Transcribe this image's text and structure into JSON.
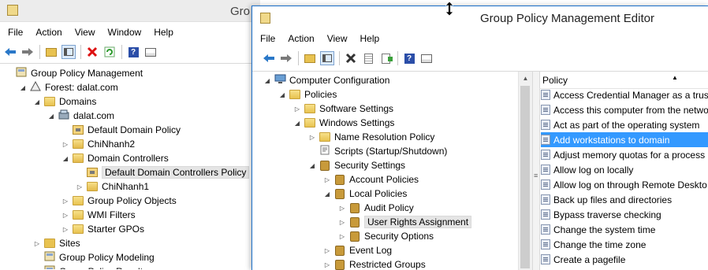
{
  "back_window": {
    "title_partial": "Gro",
    "menu": [
      "File",
      "Action",
      "View",
      "Window",
      "Help"
    ],
    "tree": [
      {
        "label": "Group Policy Management",
        "icon": "gpm-icon",
        "level": 0,
        "exp": ""
      },
      {
        "label": "Forest: dalat.com",
        "icon": "forest-icon",
        "level": 1,
        "exp": "open"
      },
      {
        "label": "Domains",
        "icon": "folder-icon",
        "level": 2,
        "exp": "open"
      },
      {
        "label": "dalat.com",
        "icon": "domain-icon",
        "level": 3,
        "exp": "open"
      },
      {
        "label": "Default Domain Policy",
        "icon": "gpo-link-icon",
        "level": 4,
        "exp": ""
      },
      {
        "label": "ChiNhanh2",
        "icon": "ou-icon",
        "level": 4,
        "exp": "closed"
      },
      {
        "label": "Domain Controllers",
        "icon": "ou-icon",
        "level": 4,
        "exp": "open"
      },
      {
        "label": "Default Domain Controllers Policy",
        "icon": "gpo-link-icon",
        "level": 5,
        "exp": "",
        "selected": true
      },
      {
        "label": "ChiNhanh1",
        "icon": "ou-icon",
        "level": 5,
        "exp": "closed"
      },
      {
        "label": "Group Policy Objects",
        "icon": "folder-icon",
        "level": 4,
        "exp": "closed"
      },
      {
        "label": "WMI Filters",
        "icon": "folder-icon",
        "level": 4,
        "exp": "closed"
      },
      {
        "label": "Starter GPOs",
        "icon": "folder-icon",
        "level": 4,
        "exp": "closed"
      },
      {
        "label": "Sites",
        "icon": "sites-icon",
        "level": 2,
        "exp": "closed"
      },
      {
        "label": "Group Policy Modeling",
        "icon": "modeling-icon",
        "level": 2,
        "exp": ""
      },
      {
        "label": "Group Policy Results",
        "icon": "results-icon",
        "level": 2,
        "exp": ""
      }
    ]
  },
  "editor": {
    "title": "Group Policy Management Editor",
    "menu": [
      "File",
      "Action",
      "View",
      "Help"
    ],
    "tree": [
      {
        "label": "Computer Configuration",
        "icon": "computer-icon",
        "level": 0,
        "exp": "open"
      },
      {
        "label": "Policies",
        "icon": "folder-icon",
        "level": 1,
        "exp": "open"
      },
      {
        "label": "Software Settings",
        "icon": "folder-icon",
        "level": 2,
        "exp": "closed"
      },
      {
        "label": "Windows Settings",
        "icon": "folder-icon",
        "level": 2,
        "exp": "open"
      },
      {
        "label": "Name Resolution Policy",
        "icon": "folder-icon",
        "level": 3,
        "exp": "closed"
      },
      {
        "label": "Scripts (Startup/Shutdown)",
        "icon": "scripts-icon",
        "level": 3,
        "exp": ""
      },
      {
        "label": "Security Settings",
        "icon": "security-icon",
        "level": 3,
        "exp": "open"
      },
      {
        "label": "Account Policies",
        "icon": "security-icon",
        "level": 4,
        "exp": "closed"
      },
      {
        "label": "Local Policies",
        "icon": "security-icon",
        "level": 4,
        "exp": "open"
      },
      {
        "label": "Audit Policy",
        "icon": "security-icon",
        "level": 5,
        "exp": "closed"
      },
      {
        "label": "User Rights Assignment",
        "icon": "security-icon",
        "level": 5,
        "exp": "closed",
        "selected": true
      },
      {
        "label": "Security Options",
        "icon": "security-icon",
        "level": 5,
        "exp": "closed"
      },
      {
        "label": "Event Log",
        "icon": "security-icon",
        "level": 4,
        "exp": "closed"
      },
      {
        "label": "Restricted Groups",
        "icon": "security-icon",
        "level": 4,
        "exp": "closed"
      }
    ],
    "list_header": "Policy",
    "policies": [
      {
        "label": "Access Credential Manager as a truste"
      },
      {
        "label": "Access this computer from the netwo"
      },
      {
        "label": "Act as part of the operating system"
      },
      {
        "label": "Add workstations to domain",
        "selected": true
      },
      {
        "label": "Adjust memory quotas for a process"
      },
      {
        "label": "Allow log on locally"
      },
      {
        "label": "Allow log on through Remote Deskto"
      },
      {
        "label": "Back up files and directories"
      },
      {
        "label": "Bypass traverse checking"
      },
      {
        "label": "Change the system time"
      },
      {
        "label": "Change the time zone"
      },
      {
        "label": "Create a pagefile"
      }
    ]
  },
  "colors": {
    "accent_blue": "#3399ff",
    "titlebar_active": "#ffffff",
    "titlebar_border": "#1a6fc9"
  }
}
